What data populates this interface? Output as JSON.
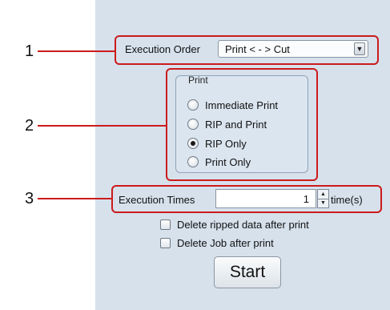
{
  "callouts": [
    "1",
    "2",
    "3"
  ],
  "execution_order": {
    "label": "Execution Order",
    "selected": "Print < - > Cut",
    "arrow_icon": "dropdown-arrow"
  },
  "print_group": {
    "title": "Print",
    "options": [
      {
        "label": "Immediate Print",
        "checked": false
      },
      {
        "label": "RIP and Print",
        "checked": false
      },
      {
        "label": "RIP Only",
        "checked": true
      },
      {
        "label": "Print Only",
        "checked": false
      }
    ]
  },
  "execution_times": {
    "label": "Execution Times",
    "value": "1",
    "unit": "time(s)"
  },
  "checkboxes": [
    {
      "label": "Delete ripped data after print",
      "checked": false
    },
    {
      "label": "Delete Job after print",
      "checked": false
    }
  ],
  "start_button": {
    "label": "Start"
  },
  "colors": {
    "callout": "#cc1b1b",
    "panel_bg": "#d6e1ec"
  }
}
